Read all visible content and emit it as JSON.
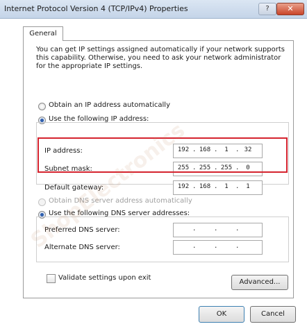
{
  "window": {
    "title": "Internet Protocol Version 4 (TCP/IPv4) Properties",
    "help_label": "?",
    "close_label": "✕"
  },
  "tabs": [
    {
      "label": "General"
    }
  ],
  "description": "You can get IP settings assigned automatically if your network supports this capability. Otherwise, you need to ask your network administrator for the appropriate IP settings.",
  "ip_section": {
    "obtain_auto_label": "Obtain an IP address automatically",
    "use_following_label": "Use the following IP address:",
    "selected": "use_following",
    "ip_address": {
      "label": "IP address:",
      "octets": [
        "192",
        "168",
        "1",
        "32"
      ]
    },
    "subnet_mask": {
      "label": "Subnet mask:",
      "octets": [
        "255",
        "255",
        "255",
        "0"
      ]
    },
    "default_gateway": {
      "label": "Default gateway:",
      "octets": [
        "192",
        "168",
        "1",
        "1"
      ]
    }
  },
  "dns_section": {
    "obtain_auto_label": "Obtain DNS server address automatically",
    "use_following_label": "Use the following DNS server addresses:",
    "selected": "use_following",
    "preferred": {
      "label": "Preferred DNS server:",
      "octets": [
        "",
        "",
        "",
        ""
      ]
    },
    "alternate": {
      "label": "Alternate DNS server:",
      "octets": [
        "",
        "",
        "",
        ""
      ]
    }
  },
  "validate_label": "Validate settings upon exit",
  "validate_checked": false,
  "buttons": {
    "advanced": "Advanced...",
    "ok": "OK",
    "cancel": "Cancel"
  },
  "watermark": "ShopElectronics",
  "colors": {
    "highlight_border": "#d5232e",
    "title_bar": "#c4d4e8",
    "selected_radio": "#2f5fae"
  }
}
